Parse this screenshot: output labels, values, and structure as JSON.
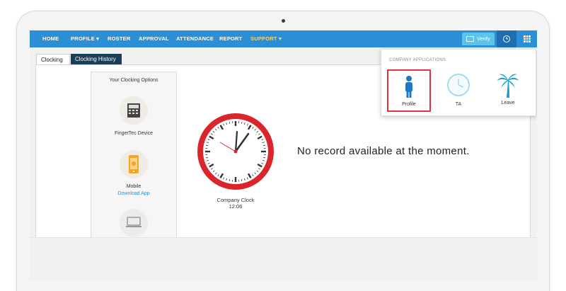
{
  "nav": {
    "items": [
      "HOME",
      "PROFILE ▾",
      "ROSTER",
      "APPROVAL",
      "ATTENDANCE",
      "REPORT",
      "SUPPORT ▾"
    ],
    "verify_label": "Verify"
  },
  "tabs": {
    "clocking": "Clocking",
    "history": "Clocking History"
  },
  "options": {
    "title": "Your Clocking Options",
    "fingertec_label": "FingerTec Device",
    "mobile_label": "Mobile",
    "mobile_link": "Download App"
  },
  "clock": {
    "label": "Company Clock",
    "time": "12:06"
  },
  "message": "No record available at the moment.",
  "dropdown": {
    "heading": "COMPANY APPLICATIONS",
    "apps": [
      {
        "label": "Profile",
        "icon": "person-icon",
        "selected": true
      },
      {
        "label": "TA",
        "icon": "clock-icon",
        "selected": false
      },
      {
        "label": "Leave",
        "icon": "palm-tree-icon",
        "selected": false
      }
    ]
  },
  "colors": {
    "nav": "#2c8fd6",
    "support": "#f6d36a",
    "history_tab": "#1a3e56",
    "clock_red": "#d9252b",
    "selected_border": "#e3313f"
  }
}
